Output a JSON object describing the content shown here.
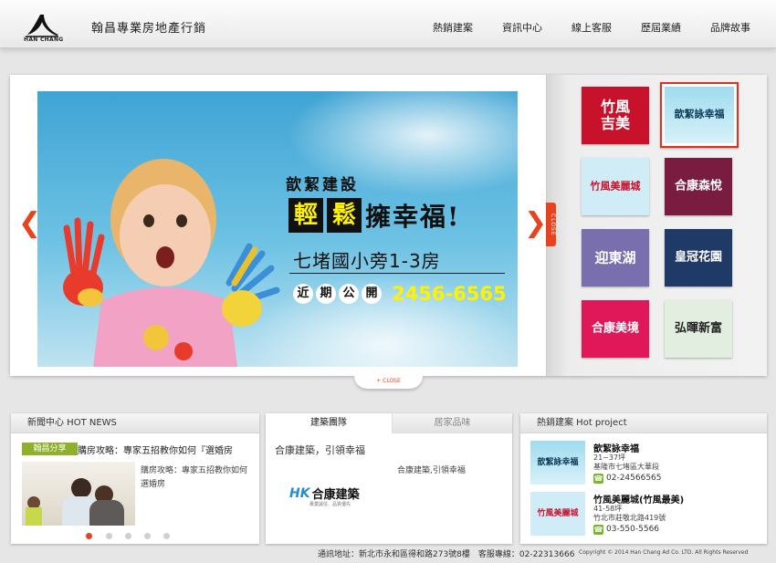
{
  "header": {
    "logo_text": "HAN CHANG",
    "site_title": "翰昌專業房地產行銷",
    "nav": [
      "熱銷建案",
      "資訊中心",
      "線上客服",
      "歷屆業績",
      "品牌故事"
    ]
  },
  "banner": {
    "brand": "歆絜建設",
    "headline_1": "輕",
    "headline_2": "鬆",
    "headline_3": "擁幸福!",
    "subline": "七堵國小旁1-3房",
    "coming_1": "近",
    "coming_2": "期",
    "coming_3": "公",
    "coming_4": "開",
    "phone": "2456-6565",
    "prev_arrow": "❮",
    "next_arrow": "❯",
    "close_side": "CLOSE",
    "close_bottom": "+ CLOSE"
  },
  "thumbs": [
    {
      "label": "竹風\n吉美",
      "color": "#c8122c"
    },
    {
      "label": "歆絜詠幸福",
      "color": "#7fd0e6"
    },
    {
      "label": "竹風美麗城",
      "color": "#bfe4f2"
    },
    {
      "label": "合康森悅",
      "color": "#7a1c3f"
    },
    {
      "label": "迎東湖",
      "color": "#7a6fae"
    },
    {
      "label": "皇冠花園",
      "color": "#1f3a66"
    },
    {
      "label": "合康美境",
      "color": "#e0185a"
    },
    {
      "label": "弘暉新富",
      "color": "#d8e8d6"
    }
  ],
  "news": {
    "title": "新聞中心 HOT NEWS",
    "badge": "翰昌分享",
    "headline": "購房攻略：專家五招教你如何『選婚房",
    "excerpt": "購房攻略：專家五招教你如何選婚房"
  },
  "team": {
    "tab_active": "建築團隊",
    "tab_inactive": "居家品味",
    "heading": "合康建築，引領幸福",
    "desc": "合康建築,引領幸福",
    "logo_text": "合康建築",
    "logo_tag": "專業誠信．品質優先"
  },
  "hot": {
    "title": "熱銷建案 Hot project",
    "items": [
      {
        "name": "歆絜詠幸福",
        "size": "21~37坪",
        "addr": "基隆市七堵區大華段",
        "phone": "02-24566565"
      },
      {
        "name": "竹風美麗城(竹風最美)",
        "size": "41-58坪",
        "addr": "竹北市莊敬北路419號",
        "phone": "03-550-5566"
      }
    ]
  },
  "footer": {
    "address": "通訊地址：新北市永和區得和路273號8樓　客服專線：02-22313666",
    "copyright": "Copyright © 2014 Han Chang Ad Co. LTD. All Rights Reserved"
  },
  "colors": {
    "accent": "#e8431c",
    "news_badge": "#8fb02b",
    "phone_icon": "#7ab52e"
  }
}
